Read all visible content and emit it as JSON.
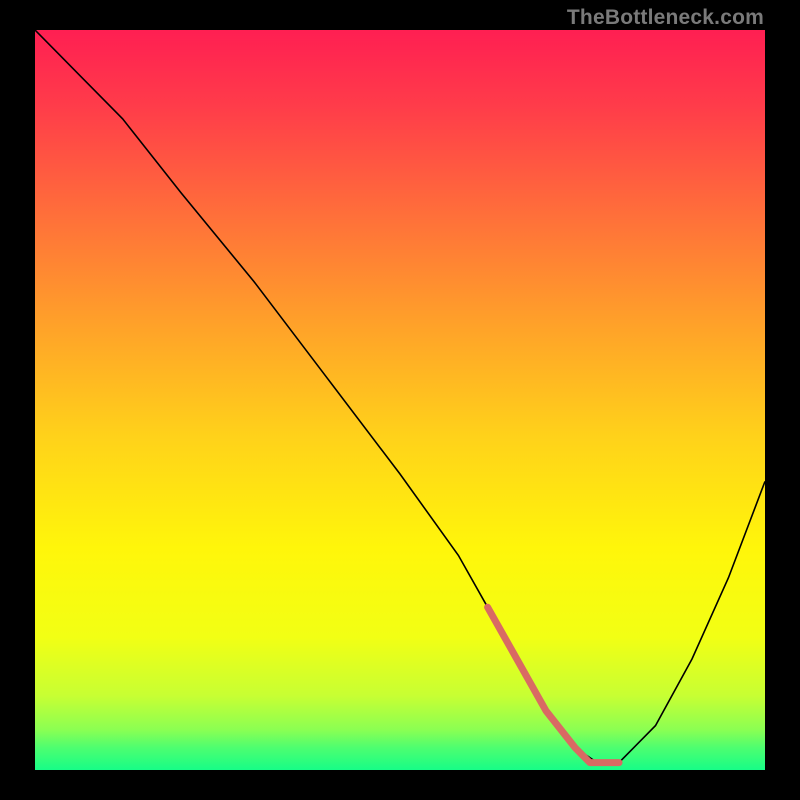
{
  "watermark": "TheBottleneck.com",
  "chart_data": {
    "type": "line",
    "title": "",
    "xlabel": "",
    "ylabel": "",
    "xlim": [
      0,
      100
    ],
    "ylim": [
      0,
      100
    ],
    "grid": false,
    "legend": false,
    "background": {
      "type": "vertical-gradient",
      "stops": [
        {
          "offset": 0.0,
          "color": "#ff1f52"
        },
        {
          "offset": 0.1,
          "color": "#ff3b4a"
        },
        {
          "offset": 0.25,
          "color": "#ff6f3a"
        },
        {
          "offset": 0.4,
          "color": "#ffa229"
        },
        {
          "offset": 0.55,
          "color": "#ffd21a"
        },
        {
          "offset": 0.7,
          "color": "#fff60a"
        },
        {
          "offset": 0.82,
          "color": "#f2ff14"
        },
        {
          "offset": 0.9,
          "color": "#c7ff33"
        },
        {
          "offset": 0.945,
          "color": "#8cff52"
        },
        {
          "offset": 0.97,
          "color": "#4dfe70"
        },
        {
          "offset": 1.0,
          "color": "#17fd87"
        }
      ]
    },
    "series": [
      {
        "name": "bottleneck-curve",
        "stroke": "#000000",
        "stroke_width": 1.6,
        "x": [
          0,
          3,
          6,
          12,
          20,
          30,
          40,
          50,
          58,
          62,
          66,
          70,
          74,
          77,
          80,
          85,
          90,
          95,
          100
        ],
        "y": [
          100,
          97,
          94,
          88,
          78,
          66,
          53,
          40,
          29,
          22,
          15,
          8,
          3,
          1,
          1,
          6,
          15,
          26,
          39
        ]
      }
    ],
    "highlight": {
      "name": "optimal-band",
      "stroke": "#d96a63",
      "stroke_width": 7,
      "x": [
        62,
        66,
        70,
        74,
        76,
        77,
        78,
        80
      ],
      "y": [
        22,
        15,
        8,
        3,
        1,
        1,
        1,
        1
      ]
    }
  }
}
